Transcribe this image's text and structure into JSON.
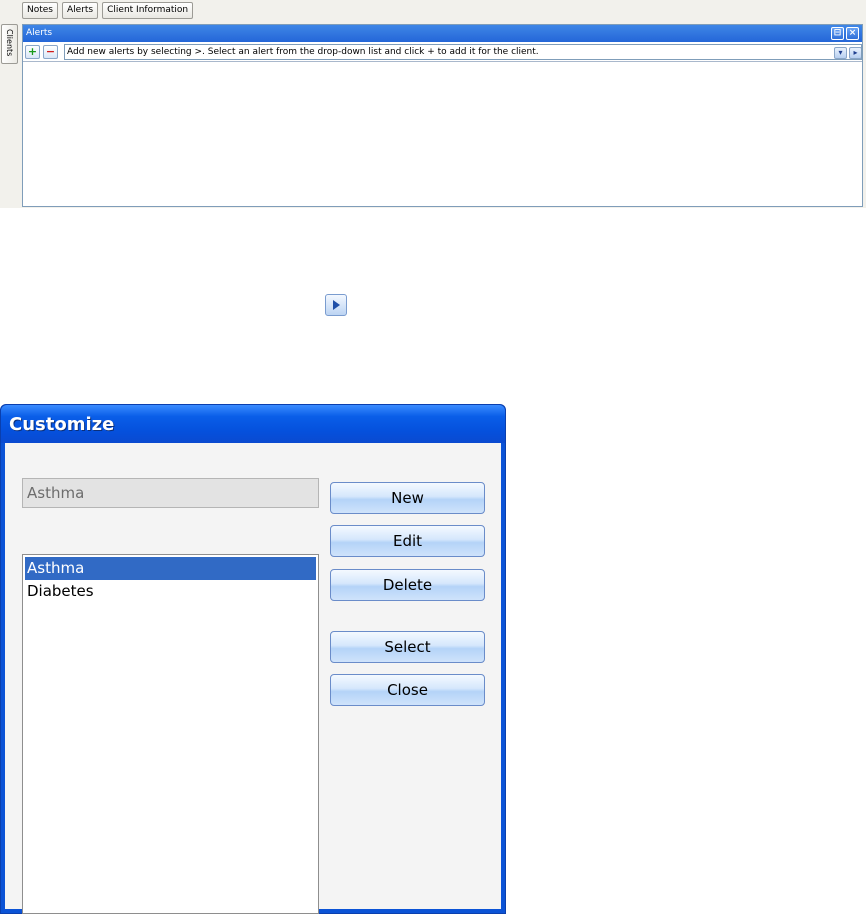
{
  "top_tabs": [
    "Notes",
    "Alerts",
    "Client Information"
  ],
  "side_tab": "Clients",
  "alerts_panel": {
    "title": "Alerts",
    "hint": "Add new alerts by selecting >. Select an alert from the drop-down list and click + to add it for the client.",
    "add_label": "+",
    "remove_label": "−"
  },
  "dialog": {
    "title": "Customize",
    "name_value": "Asthma",
    "list_items": [
      "Asthma",
      "Diabetes"
    ],
    "selected_item": "Asthma",
    "buttons": {
      "new": "New",
      "edit": "Edit",
      "delete": "Delete",
      "select": "Select",
      "close": "Close"
    }
  },
  "colors": {
    "title_bar": "#0a5ee8",
    "selection": "#316ac5",
    "panel_header": "#2466d8"
  }
}
